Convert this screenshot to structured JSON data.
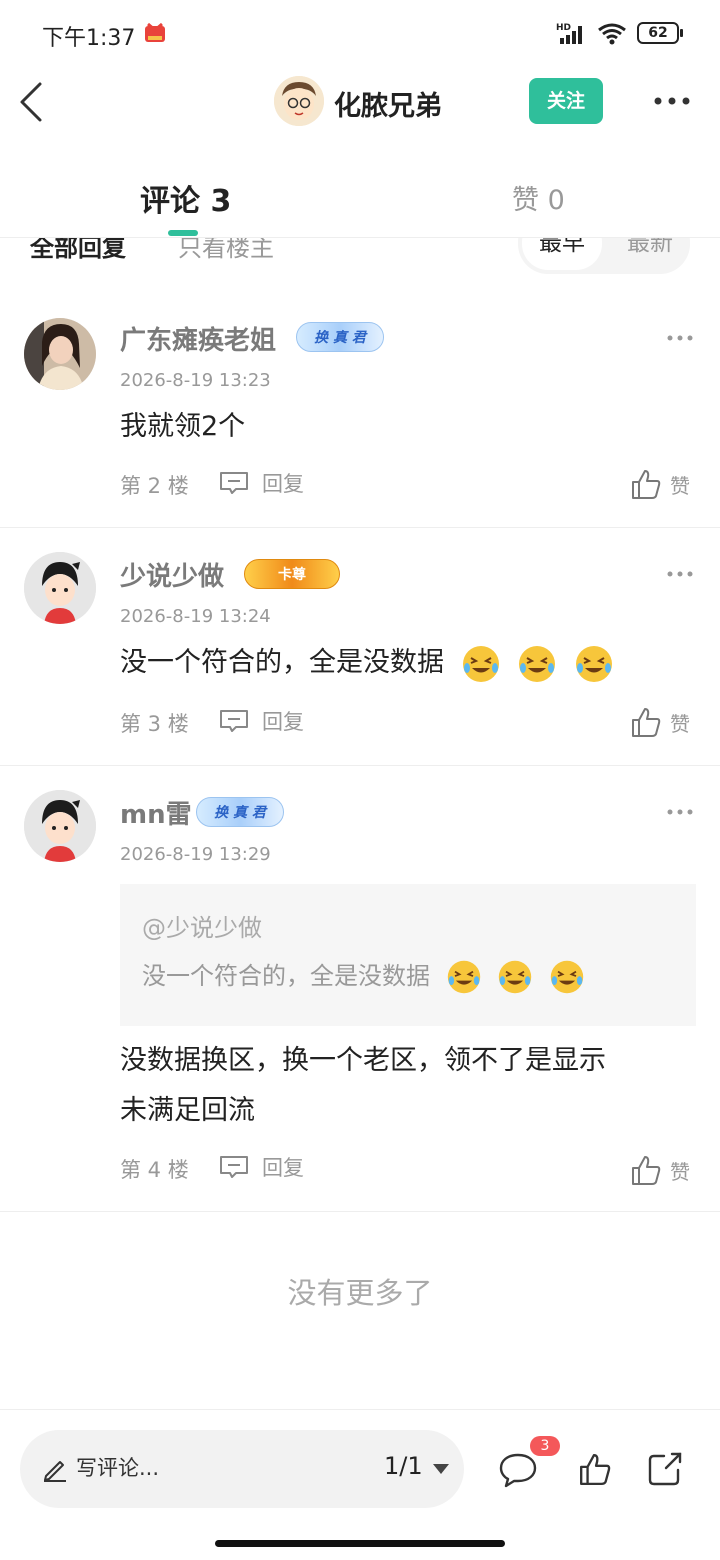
{
  "status_bar": {
    "time": "下午1:37",
    "network": "HD",
    "battery": "62"
  },
  "header": {
    "title": "化脓兄弟",
    "follow_label": "关注"
  },
  "tabs": {
    "comments": "评论 3",
    "likes": "赞 0"
  },
  "filters": {
    "all": "全部回复",
    "owner_only": "只看楼主",
    "sort_earliest": "最早",
    "sort_latest": "最新"
  },
  "comments": [
    {
      "username": "广东瘫痪老姐",
      "badge": "换 真 君",
      "time": "2026-8-19 13:23",
      "text": "我就领2个",
      "floor": "第 2 楼",
      "reply": "回复",
      "like": "赞"
    },
    {
      "username": "少说少做",
      "badge": "卡尊",
      "time": "2026-8-19 13:24",
      "text": "没一个符合的，全是没数据",
      "floor": "第 3 楼",
      "reply": "回复",
      "like": "赞"
    },
    {
      "username": "mn雷",
      "badge": "换 真 君",
      "time": "2026-8-19 13:29",
      "quote_author": "@少说少做",
      "quote_text": "没一个符合的，全是没数据",
      "text_line1": "没数据换区，换一个老区，领不了是显示",
      "text_line2": "未满足回流",
      "floor": "第 4 楼",
      "reply": "回复",
      "like": "赞"
    }
  ],
  "no_more": "没有更多了",
  "bottom_bar": {
    "placeholder": "写评论...",
    "page": "1/1",
    "comment_count": "3"
  }
}
